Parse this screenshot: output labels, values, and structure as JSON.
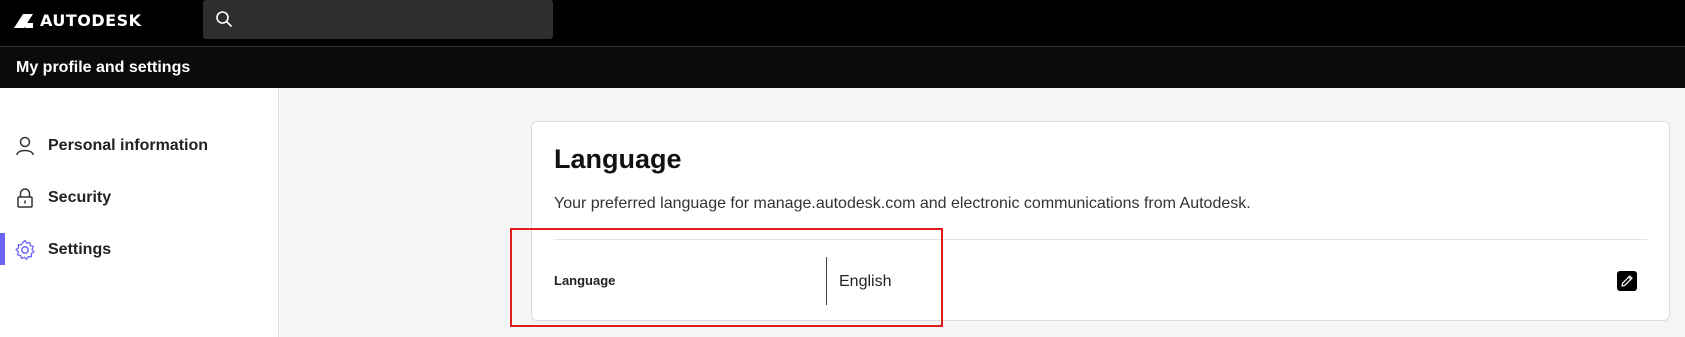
{
  "brand": {
    "name": "AUTODESK"
  },
  "search": {
    "placeholder": "",
    "icon": "search-icon"
  },
  "header": {
    "title": "My profile and settings"
  },
  "sidebar": {
    "items": [
      {
        "label": "Personal information",
        "icon": "person-icon",
        "active": false
      },
      {
        "label": "Security",
        "icon": "lock-icon",
        "active": false
      },
      {
        "label": "Settings",
        "icon": "gear-icon",
        "active": true
      }
    ],
    "active_color": "#6b63f5"
  },
  "card": {
    "title": "Language",
    "description": "Your preferred language for manage.autodesk.com and electronic communications from Autodesk.",
    "row": {
      "label": "Language",
      "value": "English",
      "action_icon": "edit-pencil-icon"
    }
  },
  "annotation": {
    "color": "#e21b1b"
  }
}
